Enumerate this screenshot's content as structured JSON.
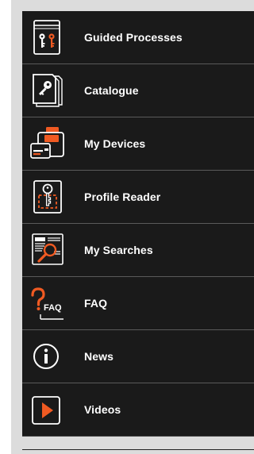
{
  "menu": {
    "items": [
      {
        "label": "Guided Processes",
        "icon": "guided-processes-book-keys-icon"
      },
      {
        "label": "Catalogue",
        "icon": "catalogue-key-icon"
      },
      {
        "label": "My Devices",
        "icon": "devices-cards-icon"
      },
      {
        "label": "Profile Reader",
        "icon": "profile-reader-key-icon"
      },
      {
        "label": "My Searches",
        "icon": "search-document-magnifier-icon"
      },
      {
        "label": "FAQ",
        "icon": "faq-question-icon"
      },
      {
        "label": "News",
        "icon": "info-icon"
      },
      {
        "label": "Videos",
        "icon": "play-icon"
      }
    ]
  },
  "colors": {
    "background": "#1a1a1a",
    "accent": "#f05a22",
    "text": "#ffffff",
    "divider": "#5a5a5a",
    "frame": "#dcdcdc"
  },
  "faq_icon_text": "FAQ"
}
